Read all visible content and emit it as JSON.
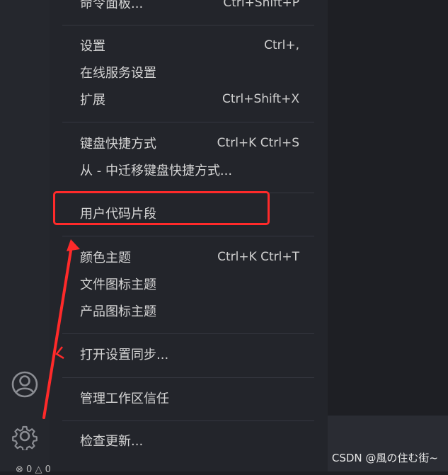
{
  "menu": {
    "top_partial": {
      "label": "命令面板...",
      "shortcut": "Ctrl+Shift+P"
    },
    "items": [
      {
        "label": "设置",
        "shortcut": "Ctrl+,"
      },
      {
        "label": "在线服务设置",
        "shortcut": ""
      },
      {
        "label": "扩展",
        "shortcut": "Ctrl+Shift+X"
      },
      {
        "label": "键盘快捷方式",
        "shortcut": "Ctrl+K Ctrl+S"
      },
      {
        "label": "从 - 中迁移键盘快捷方式...",
        "shortcut": ""
      },
      {
        "label": "用户代码片段",
        "shortcut": ""
      },
      {
        "label": "颜色主题",
        "shortcut": "Ctrl+K Ctrl+T"
      },
      {
        "label": "文件图标主题",
        "shortcut": ""
      },
      {
        "label": "产品图标主题",
        "shortcut": ""
      },
      {
        "label": "打开设置同步...",
        "shortcut": ""
      },
      {
        "label": "管理工作区信任",
        "shortcut": ""
      },
      {
        "label": "检查更新...",
        "shortcut": ""
      }
    ]
  },
  "activity_bar": {
    "icons": [
      "account-icon",
      "gear-icon"
    ]
  },
  "status_bar": {
    "errors": "0",
    "warnings": "0"
  },
  "annotation": {
    "highlight_color": "#ff2a2a"
  },
  "watermark": "CSDN @風の住む街~"
}
